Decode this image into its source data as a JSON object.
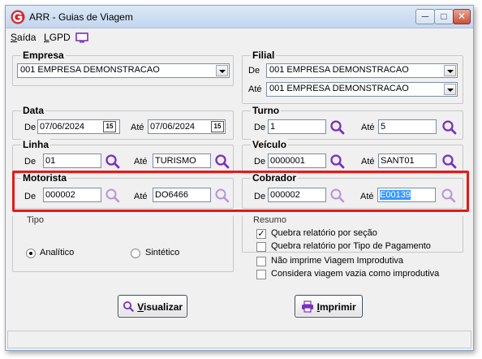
{
  "window": {
    "title": "ARR - Guias de Viagem",
    "controls": {
      "minimize": "─",
      "maximize": "□",
      "close": "✕"
    }
  },
  "menu": {
    "items": [
      {
        "label_underlined": "S",
        "label_rest": "aída"
      },
      {
        "label_underlined": "L",
        "label_rest": "GPD"
      }
    ],
    "monitor_icon": "monitor-icon"
  },
  "empresa": {
    "title": "Empresa",
    "value": "001 EMPRESA DEMONSTRACAO"
  },
  "filial": {
    "title": "Filial",
    "de_label": "De",
    "de_value": "001 EMPRESA DEMONSTRACAO",
    "ate_label": "Até",
    "ate_value": "001 EMPRESA DEMONSTRACAO"
  },
  "data": {
    "title": "Data",
    "de_label": "De",
    "de_value": "07/06/2024",
    "ate_label": "Até",
    "ate_value": "07/06/2024",
    "calendar_glyph": "15"
  },
  "turno": {
    "title": "Turno",
    "de_label": "De",
    "de_value": "1",
    "ate_label": "Até",
    "ate_value": "5"
  },
  "linha": {
    "title": "Linha",
    "de_label": "De",
    "de_value": "01",
    "ate_label": "Até",
    "ate_value": "TURISMO"
  },
  "veiculo": {
    "title": "Veículo",
    "de_label": "De",
    "de_value": "0000001",
    "ate_label": "Até",
    "ate_value": "SANT01"
  },
  "motorista": {
    "title": "Motorista",
    "de_label": "De",
    "de_value": "000002",
    "ate_label": "Até",
    "ate_value": "DO6466"
  },
  "cobrador": {
    "title": "Cobrador",
    "de_label": "De",
    "de_value": "000002",
    "ate_label": "Até",
    "ate_value": "E00139"
  },
  "tipo": {
    "title": "Tipo",
    "options": [
      {
        "label": "Analítico",
        "selected": true
      },
      {
        "label": "Sintético",
        "selected": false
      }
    ]
  },
  "resumo": {
    "title": "Resumo",
    "options": [
      {
        "label": "Quebra relatório por seção",
        "checked": true
      },
      {
        "label": "Quebra relatório por Tipo de Pagamento",
        "checked": false
      }
    ]
  },
  "extra_options": [
    {
      "label": "Não imprime Viagem Improdutiva",
      "checked": false
    },
    {
      "label": "Considera viagem vazia como improdutiva",
      "checked": false
    }
  ],
  "buttons": {
    "visualizar": {
      "underlined": "V",
      "rest": "isualizar"
    },
    "imprimir": {
      "underlined": "I",
      "rest": "mprimir"
    }
  },
  "colors": {
    "highlight_border": "#e21b1b",
    "search_icon": "#7b2fbf",
    "selection": "#3399ff"
  }
}
